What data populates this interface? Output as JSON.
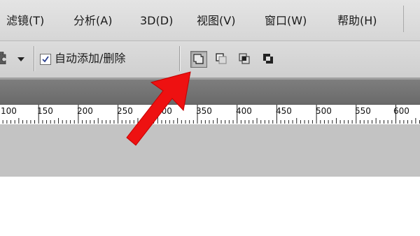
{
  "menu": {
    "items": [
      {
        "label": "滤镜(T)"
      },
      {
        "label": "分析(A)"
      },
      {
        "label": "3D(D)"
      },
      {
        "label": "视图(V)"
      },
      {
        "label": "窗口(W)"
      },
      {
        "label": "帮助(H)"
      }
    ]
  },
  "options": {
    "auto_add_delete_label": "自动添加/删除",
    "auto_add_delete_checked": true,
    "path_mode_buttons": [
      {
        "icon": "add-to-path-area-icon",
        "active": true
      },
      {
        "icon": "subtract-from-path-area-icon",
        "active": false
      },
      {
        "icon": "intersect-path-areas-icon",
        "active": false
      },
      {
        "icon": "exclude-overlapping-path-areas-icon",
        "active": false
      }
    ]
  },
  "ruler": {
    "labels": [
      "100",
      "150",
      "200",
      "250",
      "300",
      "350",
      "400",
      "450",
      "500",
      "550",
      "600"
    ]
  },
  "annotation": {
    "arrow_color": "#ee1111"
  }
}
